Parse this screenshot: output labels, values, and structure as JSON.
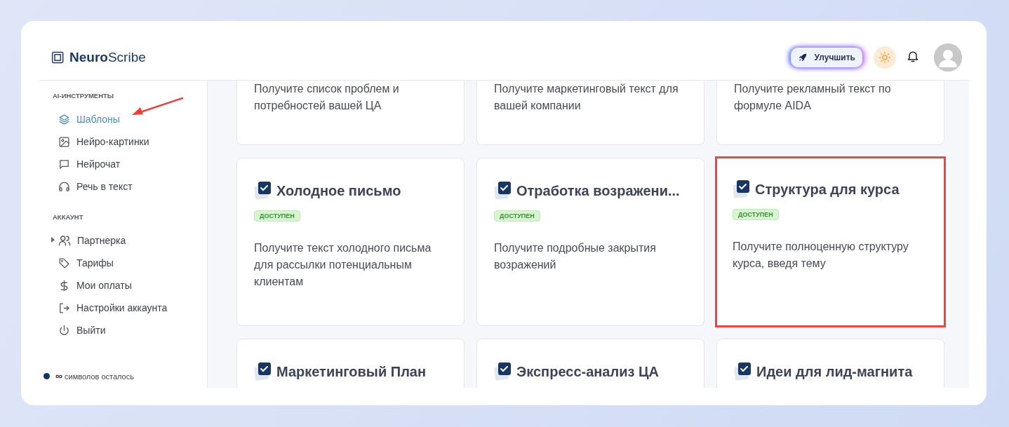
{
  "header": {
    "logo": "**Neuro**Scribe",
    "upgrade_button": "Улучшить"
  },
  "sidebar": {
    "sections": [
      {
        "title": "AI-ИНСТРУМЕНТЫ",
        "items": [
          {
            "label": "Шаблоны",
            "kind": "link",
            "selected": true,
            "annotated": true
          },
          {
            "label": "Нейро-картинки",
            "kind": "link",
            "selected": false,
            "annotated": false
          },
          {
            "label": "Нейрочат",
            "kind": "link",
            "selected": false,
            "annotated": false
          },
          {
            "label": "Речь в текст",
            "kind": "link",
            "selected": false,
            "annotated": false
          }
        ]
      },
      {
        "title": "АККАУНТ",
        "items": [
          {
            "label": "Партнерка",
            "kind": "group",
            "expanded": false,
            "selected": false,
            "annotated": false
          },
          {
            "label": "Тарифы",
            "kind": "link",
            "selected": false,
            "annotated": false
          },
          {
            "label": "Мои оплаты",
            "kind": "link",
            "selected": false,
            "annotated": false
          },
          {
            "label": "Настройки аккаунта",
            "kind": "link",
            "selected": false,
            "annotated": false
          },
          {
            "label": "Выйти",
            "kind": "link",
            "selected": false,
            "annotated": false
          }
        ]
      }
    ],
    "footer": {
      "count": "∞",
      "label": "символов осталось",
      "color": "#0f3566"
    }
  },
  "templates": [
    {
      "description": "Получите список проблем и потребностей вашей ЦА",
      "highlighted": false
    },
    {
      "description": "Получите маркетинговый текст для вашей компании",
      "highlighted": false
    },
    {
      "description": "Получите рекламный текст по формуле AIDA",
      "highlighted": false
    },
    {
      "title": "Холодное письмо",
      "badge": "ДОСТУПЕН",
      "description": "Получите текст холодного письма для рассылки потенциальным клиентам",
      "highlighted": false
    },
    {
      "title": "Отработка возражени...",
      "badge": "ДОСТУПЕН",
      "description": "Получите подробные закрытия возражений",
      "highlighted": false
    },
    {
      "title": "Структура для курса",
      "badge": "ДОСТУПЕН",
      "description": "Получите полноценную структуру курса, введя тему",
      "highlighted": true
    },
    {
      "title": "Маркетинговый План",
      "highlighted": false
    },
    {
      "title": "Экспресс-анализ ЦА",
      "highlighted": false
    },
    {
      "title": "Идеи для лид-магнита",
      "highlighted": false
    }
  ]
}
